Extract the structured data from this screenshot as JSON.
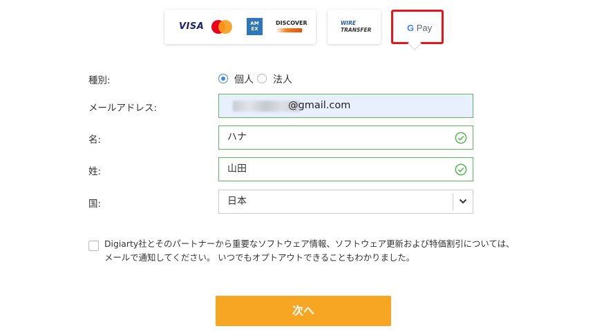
{
  "payment_methods": {
    "cards": {
      "visa": "VISA",
      "amex": "AMERICAN EXPRESS",
      "discover": "DISCOVER"
    },
    "wire": {
      "line1": "WIRE",
      "line2": "TRANSFER"
    },
    "gpay": {
      "g": "G",
      "label": "Pay"
    }
  },
  "form": {
    "type_label": "種別:",
    "type_options": {
      "individual": "個人",
      "corporate": "法人"
    },
    "type_selected": "個人",
    "email_label": "メールアドレス:",
    "email_value": "@gmail.com",
    "first_name_label": "名:",
    "first_name_value": "ハナ",
    "last_name_label": "姓:",
    "last_name_value": "山田",
    "country_label": "国:",
    "country_value": "日本"
  },
  "consent": {
    "text": "Digiarty社とそのパートナーから重要なソフトウェア情報、ソフトウェア更新および特価割引については、メールで通知してください。 いつでもオプトアウトできることもわかりました。"
  },
  "actions": {
    "next_label": "次へ"
  },
  "colors": {
    "accent": "#f7a623",
    "valid": "#5cb85c",
    "highlight": "#e8141c",
    "radio": "#3b88e0"
  }
}
